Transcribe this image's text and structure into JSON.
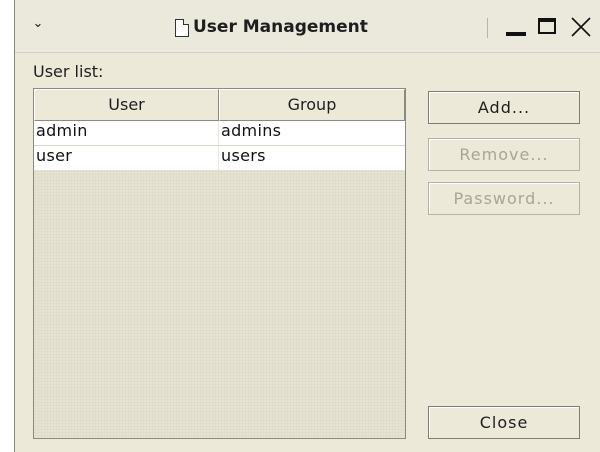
{
  "window": {
    "title": "User Management",
    "menu_glyph": "⌄"
  },
  "userlist": {
    "label": "User list:",
    "columns": [
      "User",
      "Group"
    ],
    "rows": [
      {
        "user": "admin",
        "group": "admins"
      },
      {
        "user": "user",
        "group": "users"
      }
    ]
  },
  "buttons": {
    "add": "Add...",
    "remove": "Remove...",
    "password": "Password...",
    "close": "Close"
  }
}
